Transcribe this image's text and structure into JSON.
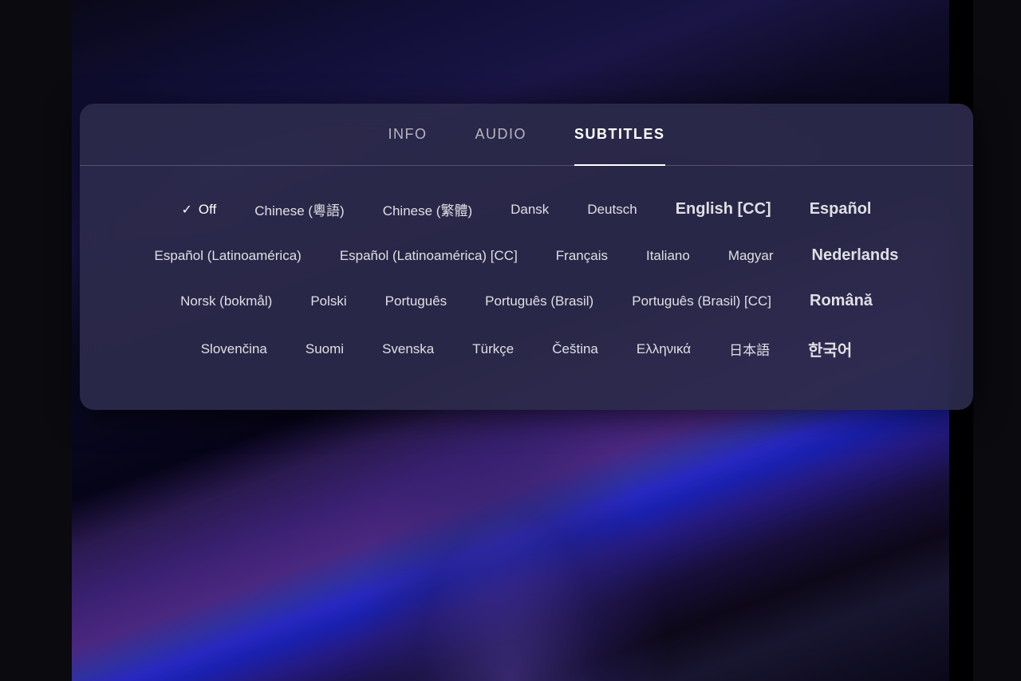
{
  "background": {
    "description": "Video player background with person in costume"
  },
  "modal": {
    "tabs": [
      {
        "id": "info",
        "label": "INFO",
        "active": false
      },
      {
        "id": "audio",
        "label": "AUDIO",
        "active": false
      },
      {
        "id": "subtitles",
        "label": "SUBTITLES",
        "active": true
      }
    ],
    "subtitle_options": {
      "rows": [
        [
          {
            "id": "off",
            "label": "Off",
            "selected": true,
            "has_check": true
          },
          {
            "id": "chinese-cantonese",
            "label": "Chinese (粵語)",
            "selected": false
          },
          {
            "id": "chinese-traditional",
            "label": "Chinese (繁體)",
            "selected": false
          },
          {
            "id": "dansk",
            "label": "Dansk",
            "selected": false
          },
          {
            "id": "deutsch",
            "label": "Deutsch",
            "selected": false
          },
          {
            "id": "english-cc",
            "label": "English [CC]",
            "selected": false,
            "large": true
          },
          {
            "id": "espanol",
            "label": "Español",
            "selected": false,
            "large": true
          }
        ],
        [
          {
            "id": "espanol-latin",
            "label": "Español (Latinoamérica)",
            "selected": false
          },
          {
            "id": "espanol-latin-cc",
            "label": "Español (Latinoamérica) [CC]",
            "selected": false
          },
          {
            "id": "francais",
            "label": "Français",
            "selected": false
          },
          {
            "id": "italiano",
            "label": "Italiano",
            "selected": false
          },
          {
            "id": "magyar",
            "label": "Magyar",
            "selected": false
          },
          {
            "id": "nederlands",
            "label": "Nederlands",
            "selected": false,
            "large": true
          }
        ],
        [
          {
            "id": "norsk",
            "label": "Norsk (bokmål)",
            "selected": false
          },
          {
            "id": "polski",
            "label": "Polski",
            "selected": false
          },
          {
            "id": "portugues",
            "label": "Português",
            "selected": false
          },
          {
            "id": "portugues-brasil",
            "label": "Português (Brasil)",
            "selected": false
          },
          {
            "id": "portugues-brasil-cc",
            "label": "Português (Brasil) [CC]",
            "selected": false
          },
          {
            "id": "romana",
            "label": "Română",
            "selected": false,
            "large": true
          }
        ],
        [
          {
            "id": "slovencina",
            "label": "Slovenčina",
            "selected": false
          },
          {
            "id": "suomi",
            "label": "Suomi",
            "selected": false
          },
          {
            "id": "svenska",
            "label": "Svenska",
            "selected": false
          },
          {
            "id": "turkce",
            "label": "Türkçe",
            "selected": false
          },
          {
            "id": "cestina",
            "label": "Čeština",
            "selected": false
          },
          {
            "id": "greek",
            "label": "Ελληνικά",
            "selected": false
          },
          {
            "id": "japanese",
            "label": "日本語",
            "selected": false
          },
          {
            "id": "korean",
            "label": "한국어",
            "selected": false,
            "large": true
          }
        ]
      ]
    }
  }
}
